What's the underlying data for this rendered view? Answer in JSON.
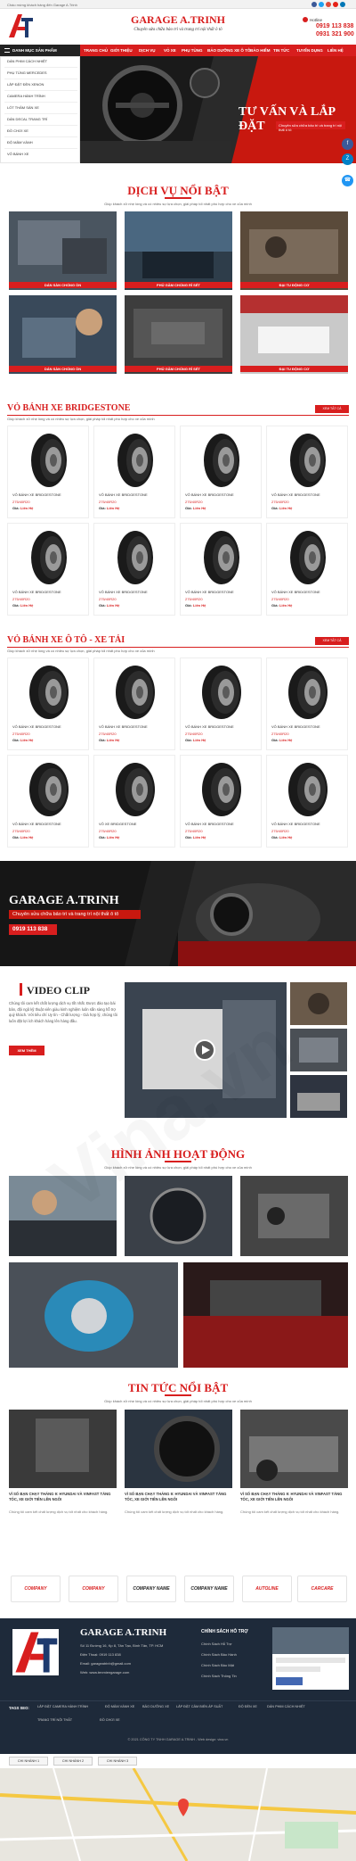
{
  "topbar": {
    "welcome": "Chào mừng khách hàng đến Garage A.Trinh"
  },
  "header": {
    "logo_text": "AT",
    "name": "GARAGE A.TRINH",
    "slogan": "Chuyên sửa chữa bảo trì và trang trí nội thất ô tô",
    "hotline_label": "Hotline",
    "phone1": "0919 113 838",
    "phone2": "0931 321 900"
  },
  "nav": {
    "category_label": "DANH MỤC SẢN PHẨM",
    "items": [
      "TRANG CHỦ",
      "GIỚI THIỆU",
      "DỊCH VỤ",
      "VỎ XE",
      "PHỤ TÙNG",
      "BẢO DƯỠNG XE Ô TÔ",
      "BẢO HIỂM",
      "TIN TỨC",
      "TUYỂN DỤNG",
      "LIÊN HỆ"
    ]
  },
  "sidebar_menu": [
    "DÁN PHIM CÁCH NHIỆT",
    "PHỤ TÙNG MERCEDES",
    "LẮP ĐẶT ĐÈN XENON",
    "CAMERA HÀNH TRÌNH",
    "LÓT THẢM SÀN XE",
    "DÁN DECAL TRANG TRÍ",
    "ĐỒ CHƠI XE",
    "ĐỘ MÂM VÀNH",
    "VỎ BÁNH XE"
  ],
  "banner": {
    "headline": "TƯ VẤN VÀ LẮP ĐẶT",
    "sub": "Chuyên sửa chữa bảo trì và trang trí nội thất ô tô"
  },
  "featured": {
    "title": "DỊCH VỤ NỔI BẬT",
    "desc": "Giúp khách xử nhẹ lòng và có nhiều sự lựa chọn, giải pháp tối nhất phù hợp cho xe của mình",
    "cards": [
      "DÁN SÀN CHỐNG ỒN",
      "PHỦ GẦM CHỐNG RỈ SÉT",
      "ĐẠI TU ĐỘNG CƠ",
      "DÁN SÀN CHỐNG ỒN",
      "PHỦ GẦM CHỐNG RỈ SÉT",
      "ĐẠI TU ĐỘNG CƠ"
    ]
  },
  "sec1": {
    "title": "VỎ BÁNH XE BRIDGESTONE",
    "desc": "Giúp khách xử nhẹ lòng và có nhiều sự lựa chọn, giải pháp tối nhất phù hợp cho xe của mình",
    "btn": "XEM TẤT CẢ",
    "products": [
      {
        "name": "VỎ BÁNH XE BRIDGESTONE",
        "code": "275/40R20",
        "price_label": "Giá:",
        "price": "Liên Hệ"
      },
      {
        "name": "VỎ BÁNH XE BRIDGESTONE",
        "code": "275/40R20",
        "price_label": "Giá:",
        "price": "Liên Hệ"
      },
      {
        "name": "VỎ BÁNH XE BRIDGESTONE",
        "code": "275/40R20",
        "price_label": "Giá:",
        "price": "Liên Hệ"
      },
      {
        "name": "VỎ BÁNH XE BRIDGESTONE",
        "code": "275/40R20",
        "price_label": "Giá:",
        "price": "Liên Hệ"
      },
      {
        "name": "VỎ BÁNH XE BRIDGESTONE",
        "code": "275/40R20",
        "price_label": "Giá:",
        "price": "Liên Hệ"
      },
      {
        "name": "VỎ BÁNH XE BRIDGESTONE",
        "code": "275/40R20",
        "price_label": "Giá:",
        "price": "Liên Hệ"
      },
      {
        "name": "VỎ BÁNH XE BRIDGESTONE",
        "code": "275/40R20",
        "price_label": "Giá:",
        "price": "Liên Hệ"
      },
      {
        "name": "VỎ BÁNH XE BRIDGESTONE",
        "code": "275/40R20",
        "price_label": "Giá:",
        "price": "Liên Hệ"
      }
    ]
  },
  "sec2": {
    "title": "VỎ BÁNH XE Ô TÔ - XE TẢI",
    "desc": "Giúp khách xử nhẹ lòng và có nhiều sự lựa chọn, giải pháp tối nhất phù hợp cho xe của mình",
    "btn": "XEM TẤT CẢ",
    "products": [
      {
        "name": "VỎ BÁNH XE BRIDGESTONE",
        "code": "275/40R20",
        "price_label": "Giá:",
        "price": "Liên Hệ"
      },
      {
        "name": "VỎ BÁNH XE BRIDGESTONE",
        "code": "275/40R20",
        "price_label": "Giá:",
        "price": "Liên Hệ"
      },
      {
        "name": "VỎ BÁNH XE BRIDGESTONE",
        "code": "275/40R20",
        "price_label": "Giá:",
        "price": "Liên Hệ"
      },
      {
        "name": "VỎ BÁNH XE BRIDGESTONE",
        "code": "275/40R20",
        "price_label": "Giá:",
        "price": "Liên Hệ"
      },
      {
        "name": "VỎ BÁNH XE BRIDGESTONE",
        "code": "275/40R20",
        "price_label": "Giá:",
        "price": "Liên Hệ"
      },
      {
        "name": "VỎ XE BRIDGESTONE",
        "code": "275/40R20",
        "price_label": "Giá:",
        "price": "Liên Hệ"
      },
      {
        "name": "VỎ BÁNH XE BRIDGESTONE",
        "code": "275/40R20",
        "price_label": "Giá:",
        "price": "Liên Hệ"
      },
      {
        "name": "VỎ BÁNH XE BRIDGESTONE",
        "code": "275/40R20",
        "price_label": "Giá:",
        "price": "Liên Hệ"
      }
    ]
  },
  "cta": {
    "title": "GARAGE A.TRINH",
    "sub": "Chuyên sửa chữa bảo trì và trang trí nội thất ô tô",
    "phone": "0919 113 838"
  },
  "video": {
    "title": "VIDEO CLIP",
    "text": "Chúng tôi cam kết chất lượng dịch vụ tốt nhất. Được đào tạo bài bản, đội ngũ kỹ thuật viên giàu kinh nghiệm luôn sẵn sàng hỗ trợ quý khách. Với tiêu chí Uy tín - Chất lượng - Giá hợp lý, chúng tôi luôn đặt lợi ích khách hàng lên hàng đầu.",
    "btn": "XEM THÊM"
  },
  "gallery": {
    "title": "HÌNH ẢNH HOẠT ĐỘNG",
    "desc": "Giúp khách xử nhẹ lòng và có nhiều sự lựa chọn, giải pháp tối nhất phù hợp cho xe của mình"
  },
  "news": {
    "title": "TIN TỨC NỔI BẬT",
    "desc": "Giúp khách xử nhẹ lòng và có nhiều sự lựa chọn, giải pháp tối nhất phù hợp cho xe của mình",
    "items": [
      {
        "title": "VÌ SỐ BẠN CHẠY THÁNG 9: HYUNDAI VÀ VINFAST TĂNG TỐC, XE GIỚI TIÊN LÊN NGÔI",
        "desc": "Chúng tôi cam kết chất lượng dịch vụ tốt nhất cho khách hàng."
      },
      {
        "title": "VÌ SỐ BẠN CHẠY THÁNG 9: HYUNDAI VÀ VINFAST TĂNG TỐC, XE GIỚI TIÊN LÊN NGÔI",
        "desc": "Chúng tôi cam kết chất lượng dịch vụ tốt nhất cho khách hàng."
      },
      {
        "title": "VÌ SỐ BẠN CHẠY THÁNG 9: HYUNDAI VÀ VINFAST TĂNG TỐC, XE GIỚI TIÊN LÊN NGÔI",
        "desc": "Chúng tôi cam kết chất lượng dịch vụ tốt nhất cho khách hàng."
      }
    ]
  },
  "brands": [
    "COMPANY",
    "COMPANY",
    "COMPANY NAME",
    "COMPANY NAME",
    "AUTOLINE",
    "CARCARE"
  ],
  "footer": {
    "name": "GARAGE A.TRINH",
    "lines": [
      "Số 11 Đường 16, Kp 8, Tân Tạo, Bình Tân, TP. HCM",
      "Điện Thoại: 0919 113 838",
      "Email: garageatrinh@gmail.com",
      "Web: www.tenmiengarage.com"
    ],
    "policy_title": "CHÍNH SÁCH HỖ TRỢ",
    "policies": [
      "Chính Sách Hỗ Trợ",
      "Chính Sách Bảo Hành",
      "Chính Sách Bảo Mật",
      "Chính Sách Thông Tin"
    ],
    "tags_label": "TAGS SEO:",
    "tags": [
      "LẮP ĐẶT CAMERA HÀNH TRÌNH",
      "ĐỘ MÂM VÀNH XE",
      "BẢO DƯỠNG XE",
      "LẮP ĐẶT CẢM BIẾN ÁP SUẤT",
      "ĐỘ ĐÈN XE",
      "DÁN PHIM CÁCH NHIỆT",
      "TRANG TRÍ NỘI THẤT",
      "ĐỒ CHƠI XE"
    ],
    "copyright": "© 2021 CÔNG TY TNHH GARAGE A.TRINH - Web design: vina.vn"
  },
  "map": {
    "tabs": [
      "CHI NHÁNH 1",
      "CHI NHÁNH 2",
      "CHI NHÁNH 3"
    ]
  },
  "watermark": "Vina.vn",
  "colors": {
    "primary": "#d81e1e",
    "dark": "#1e2a3a"
  }
}
